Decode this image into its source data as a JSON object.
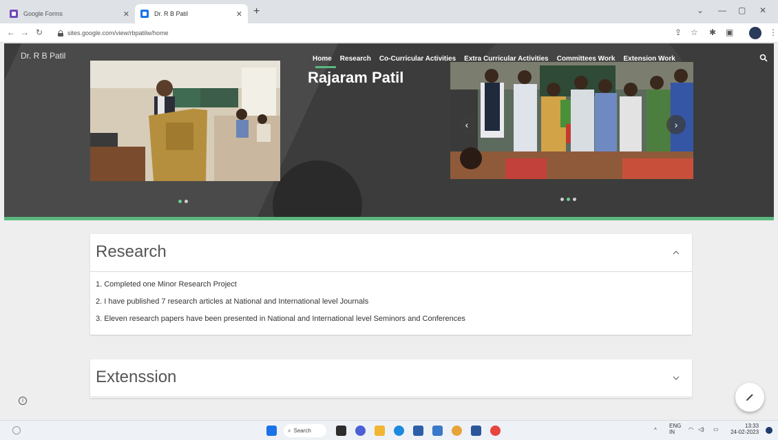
{
  "browser": {
    "tabs": [
      {
        "label": "Google Forms",
        "active": false
      },
      {
        "label": "Dr. R B Patil",
        "active": true
      }
    ],
    "url": "sites.google.com/view/rbpatilw/home"
  },
  "site": {
    "name": "Dr. R B Patil",
    "nav": [
      "Home",
      "Research",
      "Co-Curricular Activities",
      "Extra Curricular Activities",
      "Committees Work",
      "Extension Work"
    ],
    "hero_heading": "Rajaram Patil"
  },
  "research": {
    "title": "Research",
    "items": [
      "1. Completed one Minor Research Project",
      "2. I have published 7 research articles at National and International level Journals",
      "3. Eleven research papers have been presented in National and International level Seminors and Conferences"
    ]
  },
  "extension": {
    "title": "Extenssion"
  },
  "taskbar": {
    "search_label": "Search",
    "lang": "ENG",
    "region": "IN",
    "time": "13:33",
    "date": "24-02-2023"
  },
  "colors": {
    "accent": "#5bb97e",
    "header_bg": "#3c3c3c"
  }
}
